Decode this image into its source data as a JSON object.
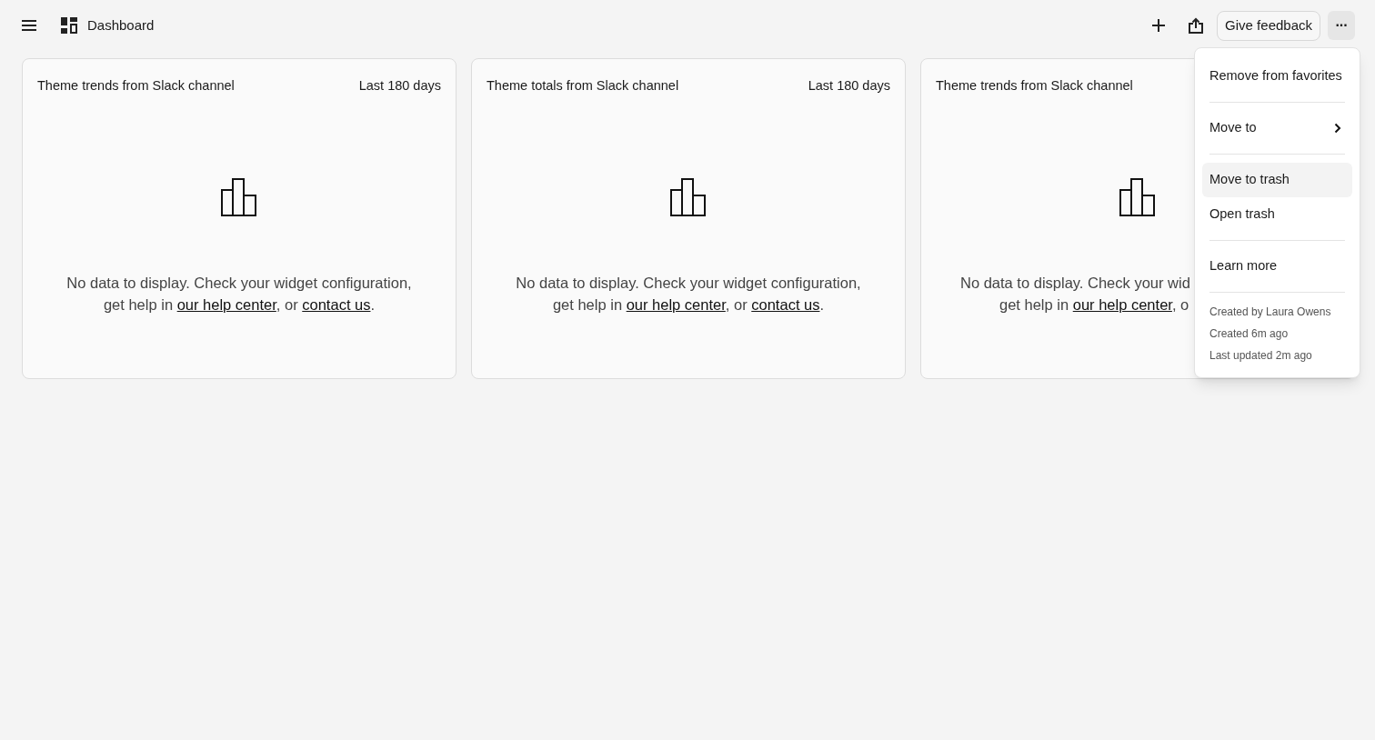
{
  "header": {
    "title": "Dashboard",
    "feedback_button": "Give feedback",
    "more_button": {
      "label": "···",
      "expanded": true
    }
  },
  "cards": [
    {
      "title": "Theme trends from Slack channel",
      "range": "Last 180 days",
      "covered": false,
      "line1": "No data to display. Check your widget configuration,",
      "prefix": "get help in ",
      "link1": "our help center",
      "sep": ", or ",
      "link2": "contact us",
      "end": "."
    },
    {
      "title": "Theme totals from Slack channel",
      "range": "Last 180 days",
      "covered": false,
      "line1": "No data to display. Check your widget configuration,",
      "prefix": "get help in ",
      "link1": "our help center",
      "sep": ", or ",
      "link2": "contact us",
      "end": "."
    },
    {
      "title": "Theme trends from Slack channel",
      "covered": true,
      "line1": "No data to display. Check your wid",
      "prefix": "get help in ",
      "link1": "our help center",
      "sep": ", o"
    }
  ],
  "menu": {
    "groups": [
      [
        {
          "label": "Remove from favorites",
          "submenu": false,
          "selected": false
        }
      ],
      [
        {
          "label": "Move to",
          "submenu": true,
          "selected": false
        }
      ],
      [
        {
          "label": "Move to trash",
          "submenu": false,
          "selected": true
        },
        {
          "label": "Open trash",
          "submenu": false,
          "selected": false
        }
      ],
      [
        {
          "label": "Learn more",
          "submenu": false,
          "selected": false
        }
      ]
    ],
    "meta": [
      "Created by Laura Owens",
      "Created 6m ago",
      "Last updated 2m ago"
    ]
  }
}
